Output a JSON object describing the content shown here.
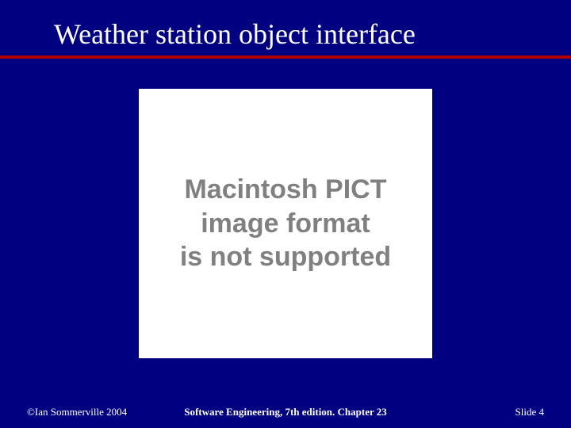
{
  "slide": {
    "title": "Weather station object interface",
    "pict_error_line1": "Macintosh PICT",
    "pict_error_line2": "image format",
    "pict_error_line3": "is not supported"
  },
  "footer": {
    "copyright": "©Ian Sommerville 2004",
    "center": "Software Engineering, 7th edition. Chapter 23",
    "slide_label": "Slide",
    "slide_number": "4"
  },
  "colors": {
    "background": "#000080",
    "divider": "#b00000",
    "text_light": "#ffffff",
    "pict_gray": "#808080"
  }
}
